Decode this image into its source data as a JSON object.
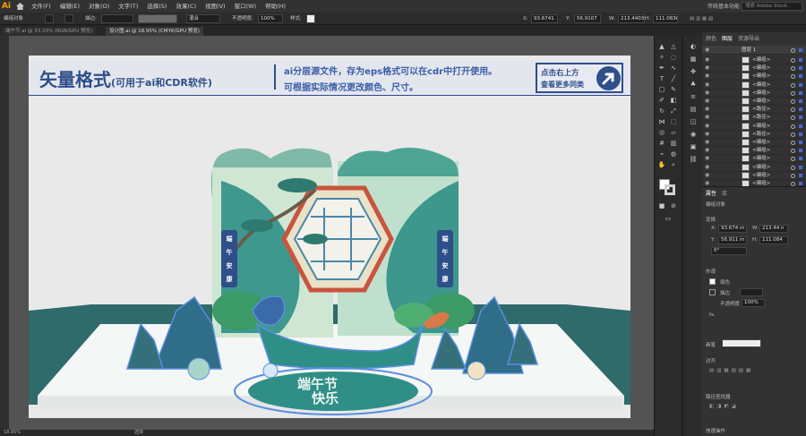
{
  "app": {
    "logo": "Ai",
    "workspace": "传统基本功能",
    "stock_search": "搜索 Adobe Stock"
  },
  "menu": [
    "文件(F)",
    "编辑(E)",
    "对象(O)",
    "文字(T)",
    "选择(S)",
    "效果(C)",
    "视图(V)",
    "窗口(W)",
    "帮助(H)"
  ],
  "control": {
    "selection_label": "编组对象",
    "stroke_label": "描边:",
    "blend_label": "混合",
    "opacity_label": "不透明度:",
    "opacity_value": "100%",
    "style_label": "样式:",
    "x_value": "93.6741",
    "y_value": "56.9107",
    "w_value": "213.4403",
    "h_value": "111.0836"
  },
  "tabs": [
    {
      "label": "端午节.ai @ 33.33% (RGB/GPU 预览)",
      "active": false
    },
    {
      "label": "设计图.ai @ 18.95% (CMYK/GPU 预览)",
      "active": true
    }
  ],
  "status": {
    "zoom": "18.95%",
    "tool": "选择"
  },
  "banner": {
    "title": "矢量格式",
    "title_sub": "(可用于ai和CDR软件)",
    "line1": "ai分层源文件，存为eps格式可以在cdr中打开使用。",
    "line2": "可根据实际情况更改颜色、尺寸。",
    "button_line1": "点击右上方",
    "button_line2": "查看更多同类"
  },
  "artwork": {
    "left_scroll": [
      "端",
      "午",
      "安",
      "康"
    ],
    "right_scroll": [
      "端",
      "午",
      "安",
      "康"
    ],
    "stage_text_1": "端午节",
    "stage_text_2": "快乐"
  },
  "layers_panel": {
    "tabs": [
      "颜色",
      "图层",
      "资源导出"
    ],
    "layer_top": "图层 1",
    "rows": [
      "<编组>",
      "<编组>",
      "<编组>",
      "<编组>",
      "<编组>",
      "<编组>",
      "<路径>",
      "<路径>",
      "<编组>",
      "<路径>",
      "<编组>",
      "<编组>",
      "<编组>",
      "<编组>",
      "<编组>",
      "<编组>"
    ]
  },
  "properties": {
    "tabs": [
      "属性",
      "库"
    ],
    "section_object": "编组对象",
    "section_transform": "变换",
    "x": "93.674 m",
    "y": "56.911 m",
    "w": "213.44 n",
    "h": "111.084",
    "angle": "0°",
    "section_appearance": "外观",
    "fill_label": "填色",
    "stroke_label": "描边",
    "opacity_label": "不透明度",
    "opacity_value": "100%",
    "fx": "fx.",
    "section_style": "画笔",
    "section_align": "对齐",
    "section_pathfinder": "路径查找器",
    "quick_actions": "快速操作"
  },
  "colors": {
    "accent": "#2e4f8a",
    "teal": "#2f8f86",
    "dark_teal": "#2e6b6a"
  }
}
